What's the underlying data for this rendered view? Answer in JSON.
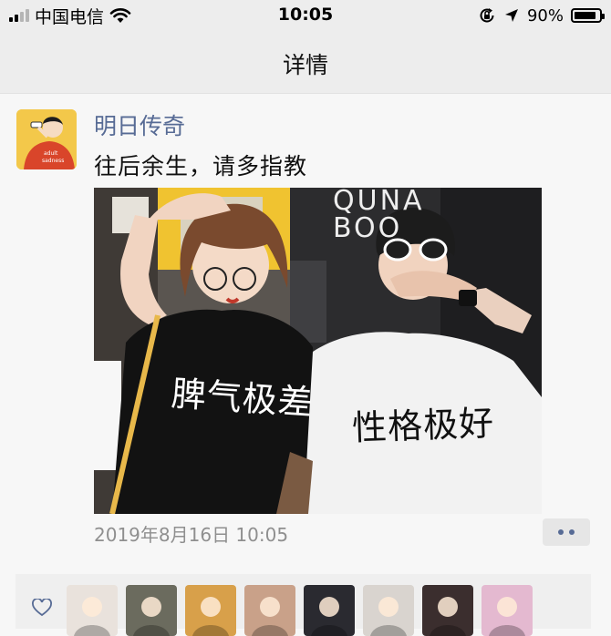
{
  "status_bar": {
    "carrier": "中国电信",
    "time": "10:05",
    "battery_percent": "90%",
    "battery_level": 0.9,
    "icons": [
      "signal-icon",
      "wifi-icon",
      "orientation-lock-icon",
      "location-icon",
      "battery-icon"
    ]
  },
  "nav": {
    "title": "详情"
  },
  "post": {
    "username": "明日传奇",
    "text": "往后余生，请多指教",
    "photo_texts": {
      "shop_sign_line1": "QUNA",
      "shop_sign_line2": "BOO",
      "left_shirt": "脾气极差",
      "right_shirt": "性格极好"
    },
    "avatar_lettering": "adult sadness",
    "timestamp": "2019年8月16日 10:05"
  },
  "likes": {
    "avatar_colors": [
      "#e9e2dc",
      "#6b6b5e",
      "#d8a04a",
      "#c9a189",
      "#2a2a30",
      "#d9d4cf",
      "#3b2e2e",
      "#e4b9d0"
    ]
  },
  "colors": {
    "link_blue": "#576b95",
    "bar_bg": "#ededed",
    "page_bg": "#f7f7f7"
  }
}
